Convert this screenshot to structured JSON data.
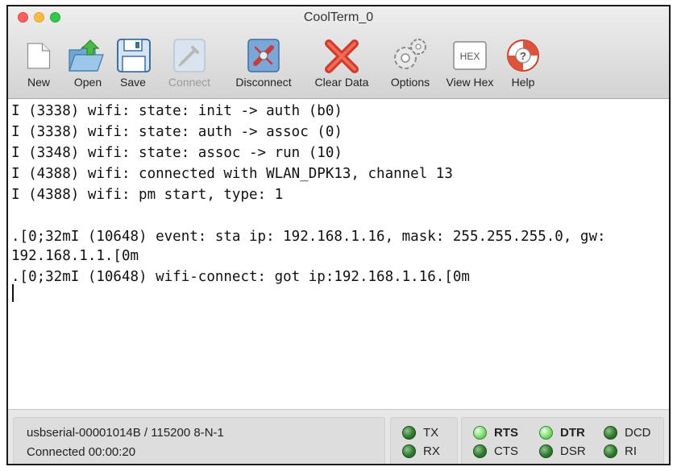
{
  "window": {
    "title": "CoolTerm_0"
  },
  "toolbar": {
    "new": "New",
    "open": "Open",
    "save": "Save",
    "connect": "Connect",
    "disconnect": "Disconnect",
    "clear_data": "Clear Data",
    "options": "Options",
    "view_hex": "View Hex",
    "help": "Help",
    "hex_badge": "HEX"
  },
  "terminal": {
    "lines": [
      "I (3338) wifi: state: init -> auth (b0)",
      "I (3338) wifi: state: auth -> assoc (0)",
      "I (3348) wifi: state: assoc -> run (10)",
      "I (4388) wifi: connected with WLAN_DPK13, channel 13",
      "I (4388) wifi: pm start, type: 1",
      "",
      ".[0;32mI (10648) event: sta ip: 192.168.1.16, mask: 255.255.255.0, gw:",
      "192.168.1.1.[0m",
      ".[0;32mI (10648) wifi-connect: got ip:192.168.1.16.[0m"
    ]
  },
  "status": {
    "port_settings": "usbserial-00001014B / 115200 8-N-1",
    "connection": "Connected 00:00:20",
    "tx": "TX",
    "rx": "RX",
    "rts": "RTS",
    "cts": "CTS",
    "dtr": "DTR",
    "dsr": "DSR",
    "dcd": "DCD",
    "ri": "RI"
  },
  "icons": {
    "new": "new-document-icon",
    "open": "open-folder-icon",
    "save": "floppy-disk-icon",
    "connect": "connect-plug-icon",
    "disconnect": "disconnect-plug-icon",
    "clear_data": "red-x-icon",
    "options": "gears-icon",
    "view_hex": "hex-icon",
    "help": "lifebuoy-icon"
  },
  "colors": {
    "led_on": "#7ddc6e",
    "led_off": "#2f7a2f",
    "close": "#fc605c",
    "minimize": "#fdbc40",
    "maximize": "#34c84a"
  }
}
